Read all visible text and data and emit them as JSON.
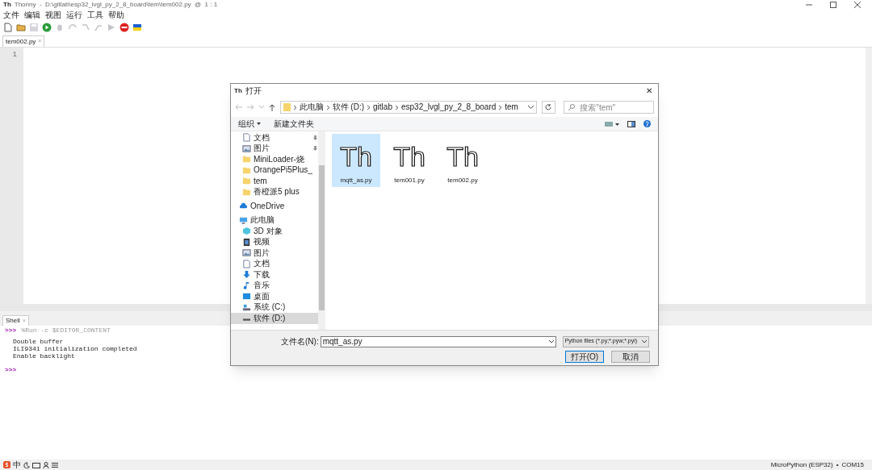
{
  "window": {
    "logo": "Th",
    "title": "Thonny  -  D:\\gitlab\\esp32_lvgl_py_2_8_board\\tem\\tem002.py  @  1 : 1"
  },
  "menu": [
    "文件",
    "编辑",
    "视图",
    "运行",
    "工具",
    "帮助"
  ],
  "toolbar": [
    {
      "kind": "new",
      "disabled": false
    },
    {
      "kind": "open",
      "disabled": false
    },
    {
      "kind": "save",
      "disabled": true
    },
    {
      "kind": "run",
      "disabled": false
    },
    {
      "kind": "debug",
      "disabled": true
    },
    {
      "kind": "step-over",
      "disabled": true
    },
    {
      "kind": "step-into",
      "disabled": true
    },
    {
      "kind": "step-out",
      "disabled": true
    },
    {
      "kind": "resume",
      "disabled": true
    },
    {
      "kind": "stop",
      "disabled": false
    },
    {
      "kind": "flag",
      "disabled": false
    }
  ],
  "editor_tabs": [
    {
      "label": "tem002.py",
      "close": "×",
      "selected": true
    }
  ],
  "editor": {
    "line_numbers": [
      "1"
    ]
  },
  "shell": {
    "tab": {
      "label": "Shell",
      "close": "×"
    },
    "lines": [
      {
        "kind": "command",
        "prompt": ">>>",
        "text": "%Run -c $EDITOR_CONTENT"
      },
      {
        "kind": "output",
        "text": "Double buffer"
      },
      {
        "kind": "output",
        "text": "ILI9341 initialization completed"
      },
      {
        "kind": "output",
        "text": "Enable backlight"
      },
      {
        "kind": "prompt",
        "prompt": ">>>"
      }
    ]
  },
  "status_bar": {
    "ime": "中",
    "interpreter": "MicroPython (ESP32)",
    "separator": "•",
    "port": "COM15"
  },
  "dialog": {
    "logo": "Th",
    "title": "打开",
    "close": "✕",
    "breadcrumbs": [
      "此电脑",
      "软件 (D:)",
      "gitlab",
      "esp32_lvgl_py_2_8_board",
      "tem"
    ],
    "search": {
      "placeholder": "搜索\"tem\""
    },
    "toolbar": {
      "organize": "组织",
      "new_folder": "新建文件夹"
    },
    "sidebar": [
      {
        "kind": "document",
        "label": "文档",
        "pinned": true,
        "selected": false
      },
      {
        "kind": "picture",
        "label": "图片",
        "pinned": true,
        "selected": false
      },
      {
        "kind": "folder",
        "label": "MiniLoader-烧",
        "pinned": false,
        "selected": false
      },
      {
        "kind": "folder",
        "label": "OrangePi5Plus_",
        "pinned": false,
        "selected": false
      },
      {
        "kind": "folder",
        "label": "tem",
        "pinned": false,
        "selected": false
      },
      {
        "kind": "folder",
        "label": "香橙派5 plus",
        "pinned": false,
        "selected": false
      },
      {
        "kind": "cloud",
        "label": "OneDrive",
        "pinned": false,
        "selected": false
      },
      {
        "kind": "computer",
        "label": "此电脑",
        "pinned": false,
        "selected": false
      },
      {
        "kind": "cube",
        "label": "3D 对象",
        "pinned": false,
        "selected": false
      },
      {
        "kind": "video",
        "label": "视频",
        "pinned": false,
        "selected": false
      },
      {
        "kind": "picture",
        "label": "图片",
        "pinned": false,
        "selected": false
      },
      {
        "kind": "document",
        "label": "文档",
        "pinned": false,
        "selected": false
      },
      {
        "kind": "download",
        "label": "下载",
        "pinned": false,
        "selected": false
      },
      {
        "kind": "music",
        "label": "音乐",
        "pinned": false,
        "selected": false
      },
      {
        "kind": "desktop",
        "label": "桌面",
        "pinned": false,
        "selected": false
      },
      {
        "kind": "system-drive",
        "label": "系统 (C:)",
        "pinned": false,
        "selected": false
      },
      {
        "kind": "drive",
        "label": "软件 (D:)",
        "pinned": false,
        "selected": true
      }
    ],
    "files": [
      {
        "name": "mqtt_as.py",
        "glyph": "Th",
        "selected": true
      },
      {
        "name": "tem001.py",
        "glyph": "Th",
        "selected": false
      },
      {
        "name": "tem002.py",
        "glyph": "Th",
        "selected": false
      }
    ],
    "file_name": {
      "label": "文件名(N):",
      "value": "mqtt_as.py"
    },
    "file_type": "Python files (*.py;*.pyw;*.pyi)",
    "buttons": [
      {
        "label": "打开(O)",
        "default": true
      },
      {
        "label": "取消",
        "default": false
      }
    ]
  }
}
